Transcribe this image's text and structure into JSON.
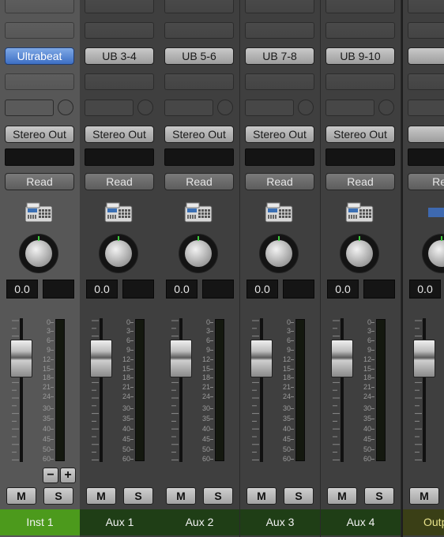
{
  "colors": {
    "instrument_name_bg": "#4c9a1c",
    "aux_name_bg": "#1f3e16",
    "output_name_bg": "#3a3f16",
    "output_name_text": "#e7e28a",
    "selected_strip_bg": "#575757",
    "strip_bg": "#3f3f3f",
    "input_button_blue": "#5a88d5"
  },
  "fader_scale_labels": [
    "0",
    "3",
    "6",
    "9",
    "12",
    "15",
    "18",
    "21",
    "24",
    "30",
    "35",
    "40",
    "45",
    "50",
    "60"
  ],
  "strips": [
    {
      "name": "Inst 1",
      "type": "instrument",
      "selected": true,
      "input": "Ultrabeat",
      "output": "Stereo Out",
      "automation": "Read",
      "icon": "drum-machine-icon",
      "pan_value": "0.0",
      "mute": "M",
      "solo": "S"
    },
    {
      "name": "Aux 1",
      "type": "aux",
      "selected": false,
      "input": "UB 3-4",
      "output": "Stereo Out",
      "automation": "Read",
      "icon": "drum-machine-icon",
      "pan_value": "0.0",
      "mute": "M",
      "solo": "S"
    },
    {
      "name": "Aux 2",
      "type": "aux",
      "selected": false,
      "input": "UB 5-6",
      "output": "Stereo Out",
      "automation": "Read",
      "icon": "drum-machine-icon",
      "pan_value": "0.0",
      "mute": "M",
      "solo": "S"
    },
    {
      "name": "Aux 3",
      "type": "aux",
      "selected": false,
      "input": "UB 7-8",
      "output": "Stereo Out",
      "automation": "Read",
      "icon": "drum-machine-icon",
      "pan_value": "0.0",
      "mute": "M",
      "solo": "S"
    },
    {
      "name": "Aux 4",
      "type": "aux",
      "selected": false,
      "input": "UB 9-10",
      "output": "Stereo Out",
      "automation": "Read",
      "icon": "drum-machine-icon",
      "pan_value": "0.0",
      "mute": "M",
      "solo": "S"
    },
    {
      "name": "Outp",
      "type": "output",
      "selected": false,
      "input": "",
      "output": "",
      "automation": "Rea",
      "icon": "output-icon",
      "pan_value": "0.0",
      "mute": "M",
      "solo": ""
    }
  ],
  "group_controls": {
    "minus": "−",
    "plus": "+"
  }
}
